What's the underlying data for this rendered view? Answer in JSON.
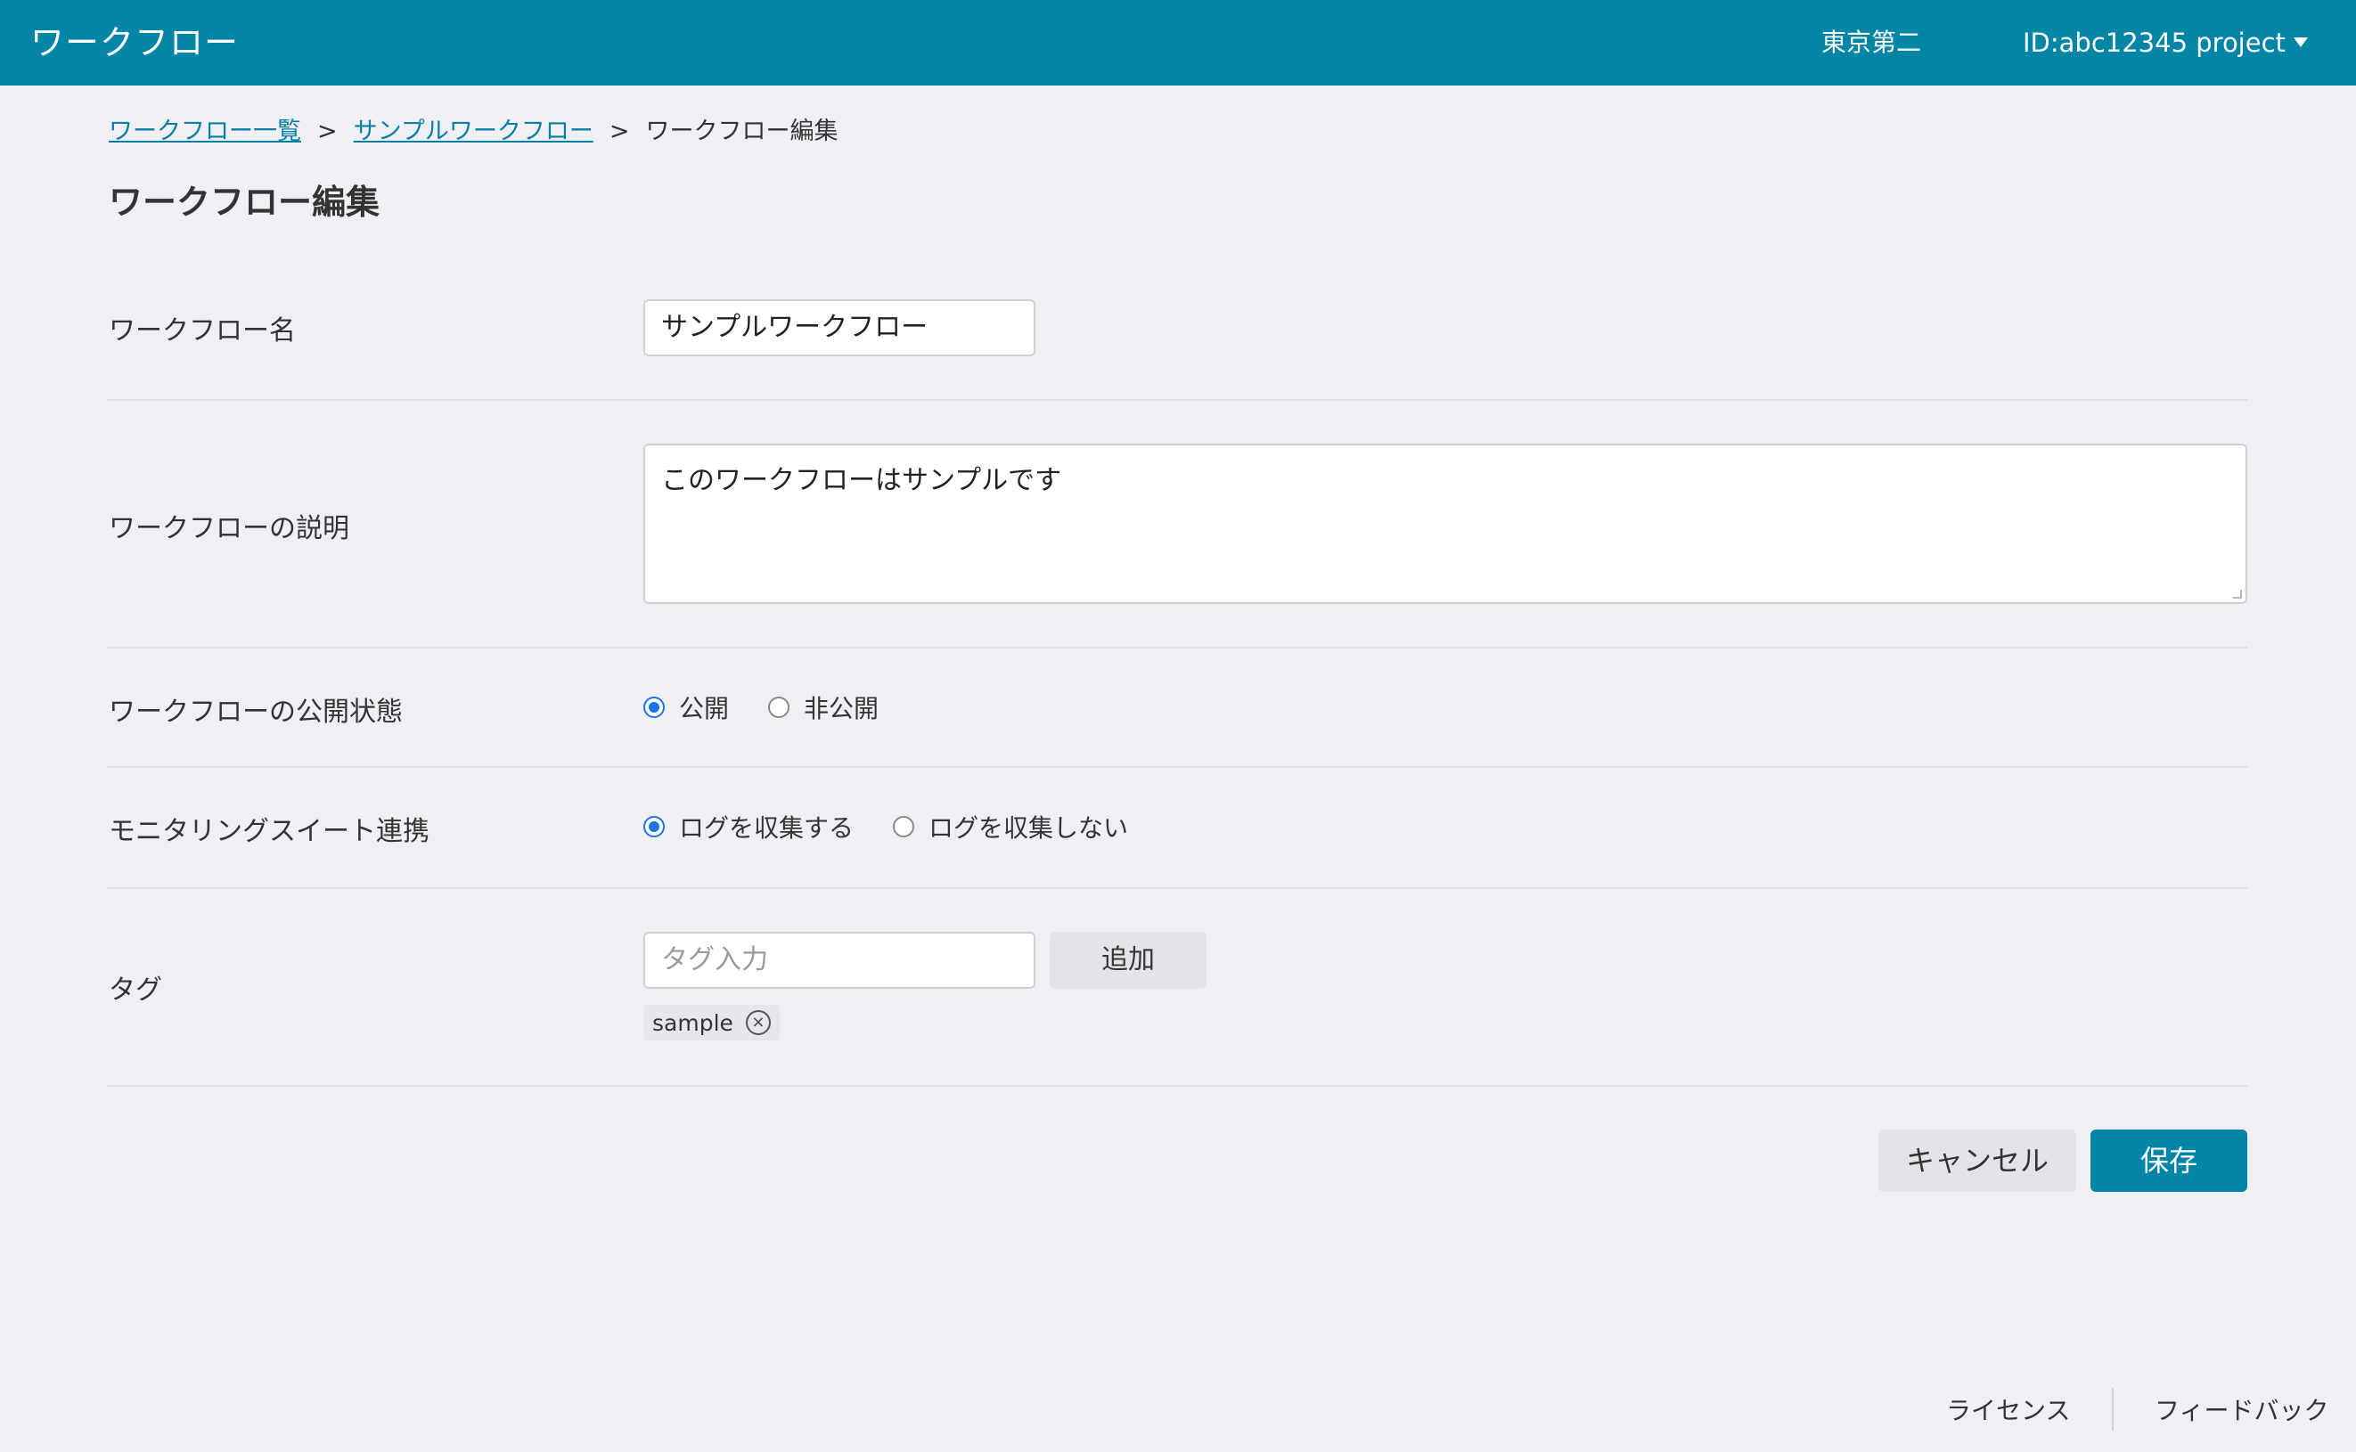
{
  "header": {
    "app_title": "ワークフロー",
    "region": "東京第二",
    "project": "ID:abc12345 project"
  },
  "breadcrumb": {
    "items": [
      "ワークフロー一覧",
      "サンプルワークフロー"
    ],
    "current": "ワークフロー編集",
    "separator": ">"
  },
  "page": {
    "title": "ワークフロー編集"
  },
  "form": {
    "name": {
      "label": "ワークフロー名",
      "value": "サンプルワークフロー"
    },
    "description": {
      "label": "ワークフローの説明",
      "value": "このワークフローはサンプルです"
    },
    "visibility": {
      "label": "ワークフローの公開状態",
      "options": [
        "公開",
        "非公開"
      ],
      "selected": "公開"
    },
    "monitoring": {
      "label": "モニタリングスイート連携",
      "options": [
        "ログを収集する",
        "ログを収集しない"
      ],
      "selected": "ログを収集する"
    },
    "tags": {
      "label": "タグ",
      "placeholder": "タグ入力",
      "add_label": "追加",
      "items": [
        "sample"
      ]
    }
  },
  "actions": {
    "cancel_label": "キャンセル",
    "save_label": "保存"
  },
  "footer": {
    "license_label": "ライセンス",
    "feedback_label": "フィードバック"
  },
  "colors": {
    "brand": "#0385a6",
    "link": "#0a7fa6",
    "radio_accent": "#1a73e8",
    "background": "#efeff4"
  },
  "icons": {
    "caret": "chevron-down-icon",
    "tag_remove": "close-circle-icon"
  }
}
